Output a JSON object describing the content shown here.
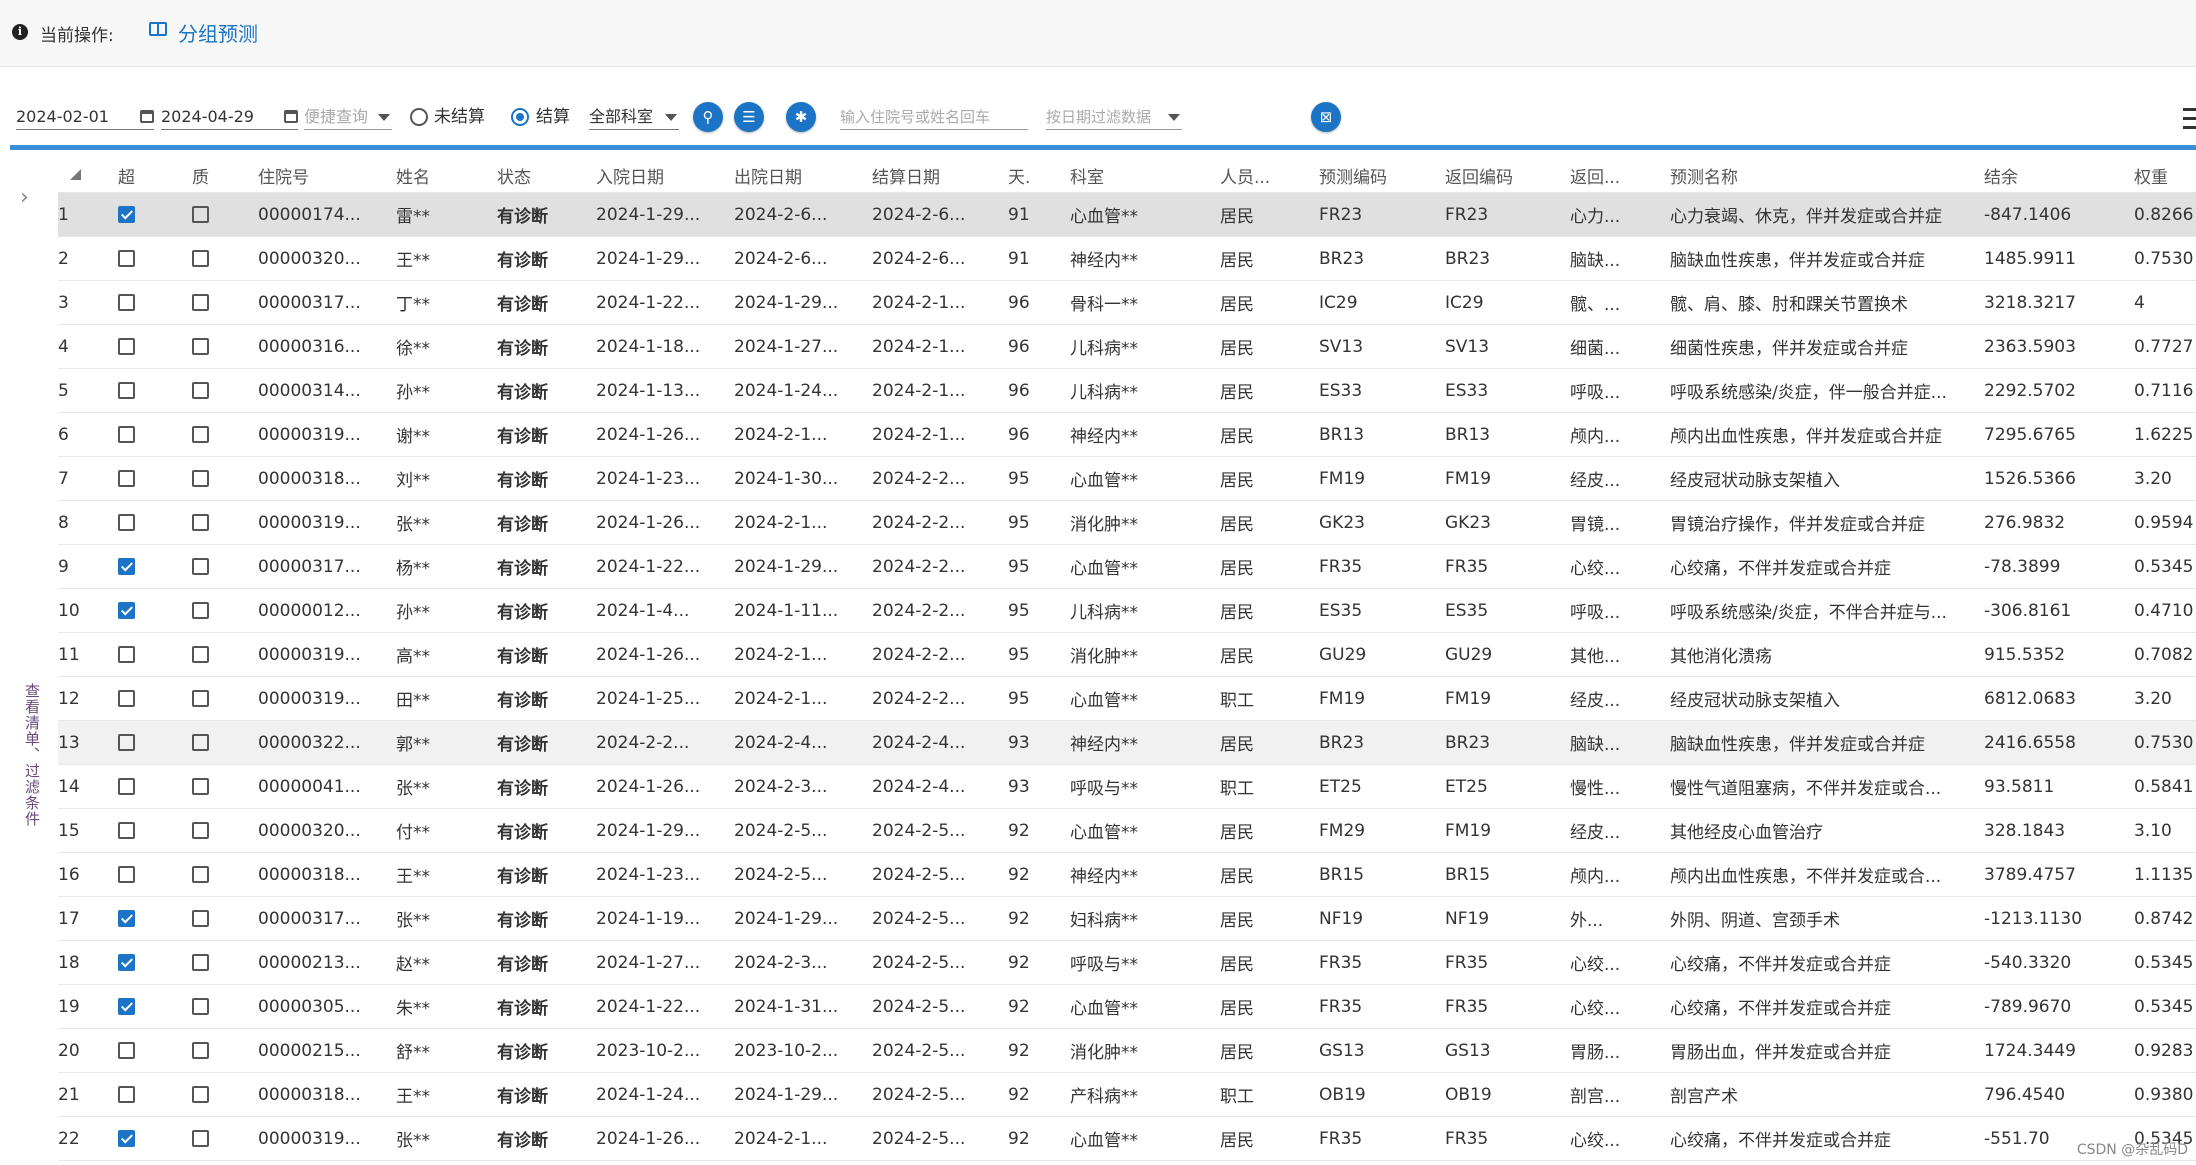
{
  "header": {
    "info_icon": "info-icon",
    "current_op_label": "当前操作:",
    "page_icon": "book-icon",
    "page_title": "分组预测"
  },
  "toolbar": {
    "date_start": "2024-02-01",
    "date_end": "2024-04-29",
    "quick_query_placeholder": "便捷查询",
    "radio_unsettled": "未结算",
    "radio_settled": "结算",
    "radio_selected": "结算",
    "department_select": "全部科室",
    "search_input_placeholder": "输入住院号或姓名回车",
    "date_filter_placeholder": "按日期过滤数据",
    "buttons": [
      "search-icon",
      "list-add-icon",
      "lightbulb-icon",
      "excel-export-icon",
      "menu-icon"
    ]
  },
  "sidebar": {
    "expand_icon": "chevron-right-icon",
    "label": "查看清单、过滤条件"
  },
  "table": {
    "columns": [
      "",
      "超",
      "质",
      "住院号",
      "姓名",
      "状态",
      "入院日期",
      "出院日期",
      "结算日期",
      "天.",
      "科室",
      "人员...",
      "预测编码",
      "返回编码",
      "返回...",
      "预测名称",
      "结余",
      "权重"
    ],
    "rows": [
      {
        "no": "1",
        "over": true,
        "qual": false,
        "id": "00000174...",
        "name": "雷**",
        "status": "有诊断",
        "in": "2024-1-29...",
        "out": "2024-2-6...",
        "settle": "2024-2-6...",
        "days": "91",
        "dept": "心血管**",
        "person": "居民",
        "pcode": "FR23",
        "rcode": "FR23",
        "rname": "心力...",
        "pname": "心力衰竭、休克，伴并发症或合并症",
        "balance": "-847.1406",
        "weight": "0.8266"
      },
      {
        "no": "2",
        "over": false,
        "qual": false,
        "id": "00000320...",
        "name": "王**",
        "status": "有诊断",
        "in": "2024-1-29...",
        "out": "2024-2-6...",
        "settle": "2024-2-6...",
        "days": "91",
        "dept": "神经内**",
        "person": "居民",
        "pcode": "BR23",
        "rcode": "BR23",
        "rname": "脑缺...",
        "pname": "脑缺血性疾患，伴并发症或合并症",
        "balance": "1485.9911",
        "weight": "0.7530"
      },
      {
        "no": "3",
        "over": false,
        "qual": false,
        "id": "00000317...",
        "name": "丁**",
        "status": "有诊断",
        "in": "2024-1-22...",
        "out": "2024-1-29...",
        "settle": "2024-2-1...",
        "days": "96",
        "dept": "骨科一**",
        "person": "居民",
        "pcode": "IC29",
        "rcode": "IC29",
        "rname": "髋、...",
        "pname": "髋、肩、膝、肘和踝关节置换术",
        "balance": "3218.3217",
        "weight": "4"
      },
      {
        "no": "4",
        "over": false,
        "qual": false,
        "id": "00000316...",
        "name": "徐**",
        "status": "有诊断",
        "in": "2024-1-18...",
        "out": "2024-1-27...",
        "settle": "2024-2-1...",
        "days": "96",
        "dept": "儿科病**",
        "person": "居民",
        "pcode": "SV13",
        "rcode": "SV13",
        "rname": "细菌...",
        "pname": "细菌性疾患，伴并发症或合并症",
        "balance": "2363.5903",
        "weight": "0.7727"
      },
      {
        "no": "5",
        "over": false,
        "qual": false,
        "id": "00000314...",
        "name": "孙**",
        "status": "有诊断",
        "in": "2024-1-13...",
        "out": "2024-1-24...",
        "settle": "2024-2-1...",
        "days": "96",
        "dept": "儿科病**",
        "person": "居民",
        "pcode": "ES33",
        "rcode": "ES33",
        "rname": "呼吸...",
        "pname": "呼吸系统感染/炎症，伴一般合并症...",
        "balance": "2292.5702",
        "weight": "0.7116"
      },
      {
        "no": "6",
        "over": false,
        "qual": false,
        "id": "00000319...",
        "name": "谢**",
        "status": "有诊断",
        "in": "2024-1-26...",
        "out": "2024-2-1...",
        "settle": "2024-2-1...",
        "days": "96",
        "dept": "神经内**",
        "person": "居民",
        "pcode": "BR13",
        "rcode": "BR13",
        "rname": "颅内...",
        "pname": "颅内出血性疾患，伴并发症或合并症",
        "balance": "7295.6765",
        "weight": "1.6225"
      },
      {
        "no": "7",
        "over": false,
        "qual": false,
        "id": "00000318...",
        "name": "刘**",
        "status": "有诊断",
        "in": "2024-1-23...",
        "out": "2024-1-30...",
        "settle": "2024-2-2...",
        "days": "95",
        "dept": "心血管**",
        "person": "居民",
        "pcode": "FM19",
        "rcode": "FM19",
        "rname": "经皮...",
        "pname": "经皮冠状动脉支架植入",
        "balance": "1526.5366",
        "weight": "3.20"
      },
      {
        "no": "8",
        "over": false,
        "qual": false,
        "id": "00000319...",
        "name": "张**",
        "status": "有诊断",
        "in": "2024-1-26...",
        "out": "2024-2-1...",
        "settle": "2024-2-2...",
        "days": "95",
        "dept": "消化肿**",
        "person": "居民",
        "pcode": "GK23",
        "rcode": "GK23",
        "rname": "胃镜...",
        "pname": "胃镜治疗操作，伴并发症或合并症",
        "balance": "276.9832",
        "weight": "0.9594"
      },
      {
        "no": "9",
        "over": true,
        "qual": false,
        "id": "00000317...",
        "name": "杨**",
        "status": "有诊断",
        "in": "2024-1-22...",
        "out": "2024-1-29...",
        "settle": "2024-2-2...",
        "days": "95",
        "dept": "心血管**",
        "person": "居民",
        "pcode": "FR35",
        "rcode": "FR35",
        "rname": "心绞...",
        "pname": "心绞痛，不伴并发症或合并症",
        "balance": "-78.3899",
        "weight": "0.5345"
      },
      {
        "no": "10",
        "over": true,
        "qual": false,
        "id": "00000012...",
        "name": "孙**",
        "status": "有诊断",
        "in": "2024-1-4...",
        "out": "2024-1-11...",
        "settle": "2024-2-2...",
        "days": "95",
        "dept": "儿科病**",
        "person": "居民",
        "pcode": "ES35",
        "rcode": "ES35",
        "rname": "呼吸...",
        "pname": "呼吸系统感染/炎症，不伴合并症与...",
        "balance": "-306.8161",
        "weight": "0.4710"
      },
      {
        "no": "11",
        "over": false,
        "qual": false,
        "id": "00000319...",
        "name": "高**",
        "status": "有诊断",
        "in": "2024-1-26...",
        "out": "2024-2-1...",
        "settle": "2024-2-2...",
        "days": "95",
        "dept": "消化肿**",
        "person": "居民",
        "pcode": "GU29",
        "rcode": "GU29",
        "rname": "其他...",
        "pname": "其他消化溃疡",
        "balance": "915.5352",
        "weight": "0.7082"
      },
      {
        "no": "12",
        "over": false,
        "qual": false,
        "id": "00000319...",
        "name": "田**",
        "status": "有诊断",
        "in": "2024-1-25...",
        "out": "2024-2-1...",
        "settle": "2024-2-2...",
        "days": "95",
        "dept": "心血管**",
        "person": "职工",
        "pcode": "FM19",
        "rcode": "FM19",
        "rname": "经皮...",
        "pname": "经皮冠状动脉支架植入",
        "balance": "6812.0683",
        "weight": "3.20"
      },
      {
        "no": "13",
        "over": false,
        "qual": false,
        "id": "00000322...",
        "name": "郭**",
        "status": "有诊断",
        "in": "2024-2-2...",
        "out": "2024-2-4...",
        "settle": "2024-2-4...",
        "days": "93",
        "dept": "神经内**",
        "person": "居民",
        "pcode": "BR23",
        "rcode": "BR23",
        "rname": "脑缺...",
        "pname": "脑缺血性疾患，伴并发症或合并症",
        "balance": "2416.6558",
        "weight": "0.7530"
      },
      {
        "no": "14",
        "over": false,
        "qual": false,
        "id": "00000041...",
        "name": "张**",
        "status": "有诊断",
        "in": "2024-1-26...",
        "out": "2024-2-3...",
        "settle": "2024-2-4...",
        "days": "93",
        "dept": "呼吸与**",
        "person": "职工",
        "pcode": "ET25",
        "rcode": "ET25",
        "rname": "慢性...",
        "pname": "慢性气道阻塞病，不伴并发症或合...",
        "balance": "93.5811",
        "weight": "0.5841"
      },
      {
        "no": "15",
        "over": false,
        "qual": false,
        "id": "00000320...",
        "name": "付**",
        "status": "有诊断",
        "in": "2024-1-29...",
        "out": "2024-2-5...",
        "settle": "2024-2-5...",
        "days": "92",
        "dept": "心血管**",
        "person": "居民",
        "pcode": "FM29",
        "rcode": "FM19",
        "rname": "经皮...",
        "pname": "其他经皮心血管治疗",
        "balance": "328.1843",
        "weight": "3.10"
      },
      {
        "no": "16",
        "over": false,
        "qual": false,
        "id": "00000318...",
        "name": "王**",
        "status": "有诊断",
        "in": "2024-1-23...",
        "out": "2024-2-5...",
        "settle": "2024-2-5...",
        "days": "92",
        "dept": "神经内**",
        "person": "居民",
        "pcode": "BR15",
        "rcode": "BR15",
        "rname": "颅内...",
        "pname": "颅内出血性疾患，不伴并发症或合...",
        "balance": "3789.4757",
        "weight": "1.1135"
      },
      {
        "no": "17",
        "over": true,
        "qual": false,
        "id": "00000317...",
        "name": "张**",
        "status": "有诊断",
        "in": "2024-1-19...",
        "out": "2024-1-29...",
        "settle": "2024-2-5...",
        "days": "92",
        "dept": "妇科病**",
        "person": "居民",
        "pcode": "NF19",
        "rcode": "NF19",
        "rname": "外...",
        "pname": "外阴、阴道、宫颈手术",
        "balance": "-1213.1130",
        "weight": "0.8742"
      },
      {
        "no": "18",
        "over": true,
        "qual": false,
        "id": "00000213...",
        "name": "赵**",
        "status": "有诊断",
        "in": "2024-1-27...",
        "out": "2024-2-3...",
        "settle": "2024-2-5...",
        "days": "92",
        "dept": "呼吸与**",
        "person": "居民",
        "pcode": "FR35",
        "rcode": "FR35",
        "rname": "心绞...",
        "pname": "心绞痛，不伴并发症或合并症",
        "balance": "-540.3320",
        "weight": "0.5345"
      },
      {
        "no": "19",
        "over": true,
        "qual": false,
        "id": "00000305...",
        "name": "朱**",
        "status": "有诊断",
        "in": "2024-1-22...",
        "out": "2024-1-31...",
        "settle": "2024-2-5...",
        "days": "92",
        "dept": "心血管**",
        "person": "居民",
        "pcode": "FR35",
        "rcode": "FR35",
        "rname": "心绞...",
        "pname": "心绞痛，不伴并发症或合并症",
        "balance": "-789.9670",
        "weight": "0.5345"
      },
      {
        "no": "20",
        "over": false,
        "qual": false,
        "id": "00000215...",
        "name": "舒**",
        "status": "有诊断",
        "in": "2023-10-2...",
        "out": "2023-10-2...",
        "settle": "2024-2-5...",
        "days": "92",
        "dept": "消化肿**",
        "person": "居民",
        "pcode": "GS13",
        "rcode": "GS13",
        "rname": "胃肠...",
        "pname": "胃肠出血，伴并发症或合并症",
        "balance": "1724.3449",
        "weight": "0.9283"
      },
      {
        "no": "21",
        "over": false,
        "qual": false,
        "id": "00000318...",
        "name": "王**",
        "status": "有诊断",
        "in": "2024-1-24...",
        "out": "2024-1-29...",
        "settle": "2024-2-5...",
        "days": "92",
        "dept": "产科病**",
        "person": "职工",
        "pcode": "OB19",
        "rcode": "OB19",
        "rname": "剖宫...",
        "pname": "剖宫产术",
        "balance": "796.4540",
        "weight": "0.9380"
      },
      {
        "no": "22",
        "over": true,
        "qual": false,
        "id": "00000319...",
        "name": "张**",
        "status": "有诊断",
        "in": "2024-1-26...",
        "out": "2024-2-1...",
        "settle": "2024-2-5...",
        "days": "92",
        "dept": "心血管**",
        "person": "居民",
        "pcode": "FR35",
        "rcode": "FR35",
        "rname": "心绞...",
        "pname": "心绞痛，不伴并发症或合并症",
        "balance": "-551.70",
        "weight": "0.5345"
      }
    ]
  },
  "watermark": "CSDN @杂乱码D",
  "colors": {
    "accent": "#1b74c5",
    "accent_line": "#3a8fd6",
    "selected_row": "#e0e0e0",
    "side_text": "#6a4a7c"
  }
}
